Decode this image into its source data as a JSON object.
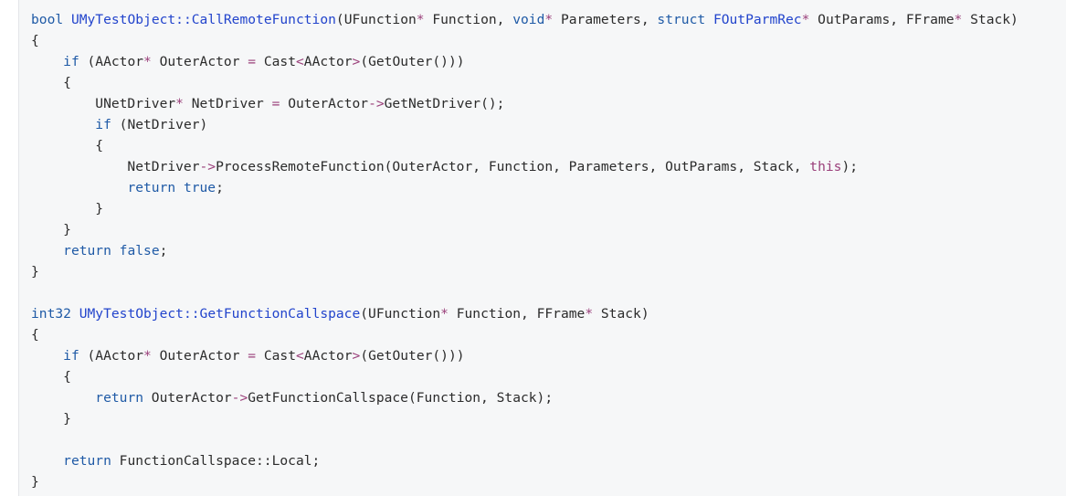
{
  "colors": {
    "keyword": "#1f5aa6",
    "function_name": "#2244cc",
    "operator": "#9a3f7a",
    "text": "#2b2b2b",
    "panel_background": "#f6f7f8"
  },
  "code": {
    "language": "C++",
    "lines": [
      [
        {
          "t": "kw",
          "v": "bool"
        },
        {
          "t": "txt",
          "v": " "
        },
        {
          "t": "fn",
          "v": "UMyTestObject::CallRemoteFunction"
        },
        {
          "t": "txt",
          "v": "(UFunction"
        },
        {
          "t": "op",
          "v": "*"
        },
        {
          "t": "txt",
          "v": " Function, "
        },
        {
          "t": "kw",
          "v": "void"
        },
        {
          "t": "op",
          "v": "*"
        },
        {
          "t": "txt",
          "v": " Parameters, "
        },
        {
          "t": "kw",
          "v": "struct"
        },
        {
          "t": "txt",
          "v": " "
        },
        {
          "t": "fn",
          "v": "FOutParmRec"
        },
        {
          "t": "op",
          "v": "*"
        },
        {
          "t": "txt",
          "v": " OutParams, FFrame"
        },
        {
          "t": "op",
          "v": "*"
        },
        {
          "t": "txt",
          "v": " Stack)"
        }
      ],
      [
        {
          "t": "txt",
          "v": "{"
        }
      ],
      [
        {
          "t": "txt",
          "v": "    "
        },
        {
          "t": "kw",
          "v": "if"
        },
        {
          "t": "txt",
          "v": " (AActor"
        },
        {
          "t": "op",
          "v": "*"
        },
        {
          "t": "txt",
          "v": " OuterActor "
        },
        {
          "t": "op",
          "v": "="
        },
        {
          "t": "txt",
          "v": " Cast"
        },
        {
          "t": "op",
          "v": "<"
        },
        {
          "t": "txt",
          "v": "AActor"
        },
        {
          "t": "op",
          "v": ">"
        },
        {
          "t": "txt",
          "v": "(GetOuter()))"
        }
      ],
      [
        {
          "t": "txt",
          "v": "    {"
        }
      ],
      [
        {
          "t": "txt",
          "v": "        UNetDriver"
        },
        {
          "t": "op",
          "v": "*"
        },
        {
          "t": "txt",
          "v": " NetDriver "
        },
        {
          "t": "op",
          "v": "="
        },
        {
          "t": "txt",
          "v": " OuterActor"
        },
        {
          "t": "op",
          "v": "->"
        },
        {
          "t": "txt",
          "v": "GetNetDriver();"
        }
      ],
      [
        {
          "t": "txt",
          "v": "        "
        },
        {
          "t": "kw",
          "v": "if"
        },
        {
          "t": "txt",
          "v": " (NetDriver)"
        }
      ],
      [
        {
          "t": "txt",
          "v": "        {"
        }
      ],
      [
        {
          "t": "txt",
          "v": "            NetDriver"
        },
        {
          "t": "op",
          "v": "->"
        },
        {
          "t": "txt",
          "v": "ProcessRemoteFunction(OuterActor, Function, Parameters, OutParams, Stack, "
        },
        {
          "t": "op",
          "v": "this"
        },
        {
          "t": "txt",
          "v": ");"
        }
      ],
      [
        {
          "t": "txt",
          "v": "            "
        },
        {
          "t": "kw",
          "v": "return"
        },
        {
          "t": "txt",
          "v": " "
        },
        {
          "t": "kw",
          "v": "true"
        },
        {
          "t": "txt",
          "v": ";"
        }
      ],
      [
        {
          "t": "txt",
          "v": "        }"
        }
      ],
      [
        {
          "t": "txt",
          "v": "    }"
        }
      ],
      [
        {
          "t": "txt",
          "v": "    "
        },
        {
          "t": "kw",
          "v": "return"
        },
        {
          "t": "txt",
          "v": " "
        },
        {
          "t": "kw",
          "v": "false"
        },
        {
          "t": "txt",
          "v": ";"
        }
      ],
      [
        {
          "t": "txt",
          "v": "}"
        }
      ],
      [
        {
          "t": "txt",
          "v": ""
        }
      ],
      [
        {
          "t": "kw",
          "v": "int32"
        },
        {
          "t": "txt",
          "v": " "
        },
        {
          "t": "fn",
          "v": "UMyTestObject::GetFunctionCallspace"
        },
        {
          "t": "txt",
          "v": "(UFunction"
        },
        {
          "t": "op",
          "v": "*"
        },
        {
          "t": "txt",
          "v": " Function, FFrame"
        },
        {
          "t": "op",
          "v": "*"
        },
        {
          "t": "txt",
          "v": " Stack)"
        }
      ],
      [
        {
          "t": "txt",
          "v": "{"
        }
      ],
      [
        {
          "t": "txt",
          "v": "    "
        },
        {
          "t": "kw",
          "v": "if"
        },
        {
          "t": "txt",
          "v": " (AActor"
        },
        {
          "t": "op",
          "v": "*"
        },
        {
          "t": "txt",
          "v": " OuterActor "
        },
        {
          "t": "op",
          "v": "="
        },
        {
          "t": "txt",
          "v": " Cast"
        },
        {
          "t": "op",
          "v": "<"
        },
        {
          "t": "txt",
          "v": "AActor"
        },
        {
          "t": "op",
          "v": ">"
        },
        {
          "t": "txt",
          "v": "(GetOuter()))"
        }
      ],
      [
        {
          "t": "txt",
          "v": "    {"
        }
      ],
      [
        {
          "t": "txt",
          "v": "        "
        },
        {
          "t": "kw",
          "v": "return"
        },
        {
          "t": "txt",
          "v": " OuterActor"
        },
        {
          "t": "op",
          "v": "->"
        },
        {
          "t": "txt",
          "v": "GetFunctionCallspace(Function, Stack);"
        }
      ],
      [
        {
          "t": "txt",
          "v": "    }"
        }
      ],
      [
        {
          "t": "txt",
          "v": ""
        }
      ],
      [
        {
          "t": "txt",
          "v": "    "
        },
        {
          "t": "kw",
          "v": "return"
        },
        {
          "t": "txt",
          "v": " FunctionCallspace::Local;"
        }
      ],
      [
        {
          "t": "txt",
          "v": "}"
        }
      ]
    ]
  }
}
